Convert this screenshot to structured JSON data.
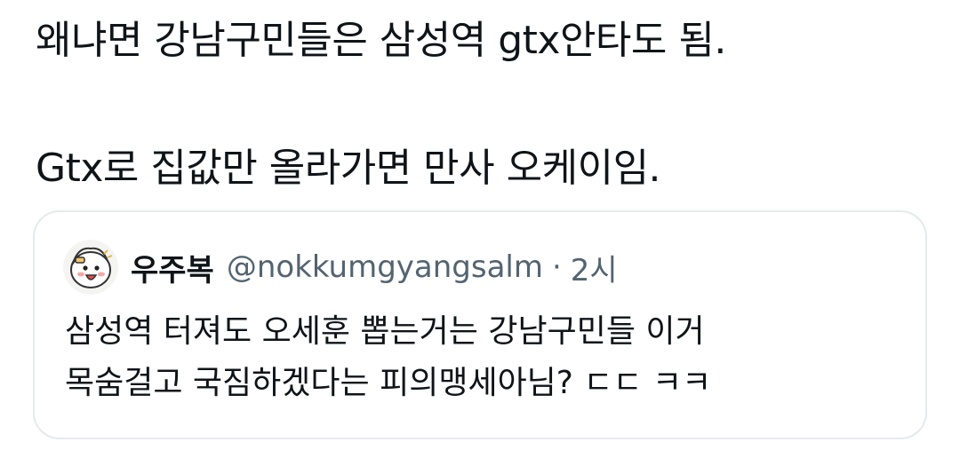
{
  "tweet": {
    "lines": [
      "왜냐면 강남구민들은 삼성역 gtx안타도 됨.",
      "",
      "Gtx로 집값만 올라가면 만사 오케이임."
    ]
  },
  "quote": {
    "author": {
      "display_name": "우주복",
      "handle": "@nokkumgyangsalm",
      "separator": "·",
      "time": "2시",
      "avatar_icon": "cartoon-character-avatar-icon"
    },
    "lines": [
      "삼성역 터져도 오세훈 뽑는거는 강남구민들 이거",
      "목숨걸고 국짐하겠다는 피의맹세아님? ㄷㄷ ㅋㅋ"
    ]
  },
  "colors": {
    "text_primary": "#0f1419",
    "text_secondary": "#536471",
    "border": "#e6e9ec",
    "background": "#ffffff"
  }
}
